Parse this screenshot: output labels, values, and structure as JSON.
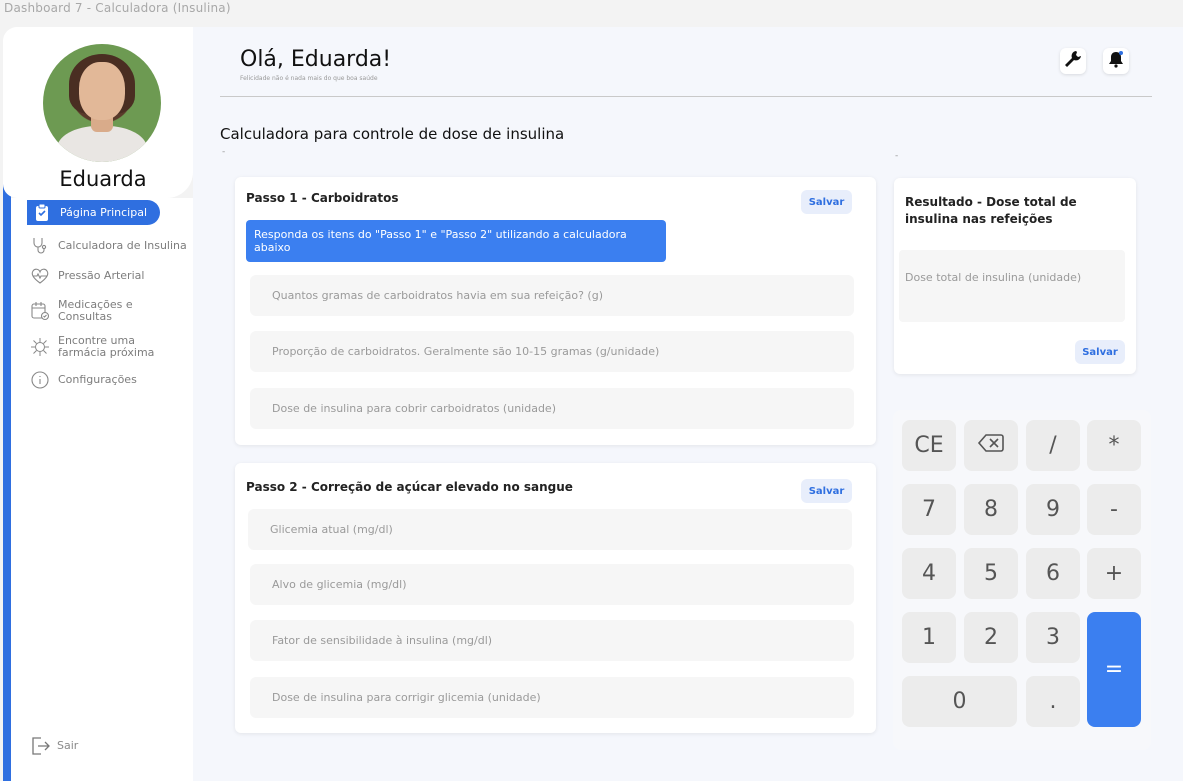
{
  "window_title": "Dashboard 7 - Calculadora (Insulina)",
  "user": {
    "name": "Eduarda"
  },
  "nav": {
    "active": "Página Principal",
    "items": [
      "Calculadora de Insulina",
      "Pressão Arterial",
      "Medicações e Consultas",
      "Encontre uma farmácia próxima",
      "Configurações"
    ],
    "logout": "Sair"
  },
  "header": {
    "greeting": "Olá, Eduarda!",
    "subtitle": "Felicidade não é nada mais do que boa saúde"
  },
  "page_title": "Calculadora para controle de dose de insulina",
  "step1": {
    "title": "Passo 1 - Carboidratos",
    "save": "Salvar",
    "banner": "Responda os itens do \"Passo 1\" e \"Passo 2\" utilizando a calculadora abaixo",
    "fields": [
      "Quantos gramas de carboidratos havia em sua refeição? (g)",
      "Proporção de carboidratos. Geralmente são 10-15 gramas (g/unidade)",
      "Dose de insulina para cobrir carboidratos (unidade)"
    ]
  },
  "step2": {
    "title": "Passo 2 - Correção de açúcar elevado no sangue",
    "save": "Salvar",
    "fields": [
      "Glicemia atual (mg/dl)",
      "Alvo de glicemia (mg/dl)",
      "Fator de sensibilidade à insulina (mg/dl)",
      "Dose de insulina para corrigir glicemia (unidade)"
    ]
  },
  "result": {
    "title": "Resultado - Dose total de insulina nas refeições",
    "field": "Dose total de insulina (unidade)",
    "save": "Salvar"
  },
  "calculator": {
    "keys": [
      "CE",
      "/",
      "*",
      "7",
      "8",
      "9",
      "-",
      "4",
      "5",
      "6",
      "+",
      "1",
      "2",
      "3",
      "=",
      "0",
      "."
    ],
    "backspace_icon": "backspace-icon"
  },
  "colors": {
    "accent": "#2f6fe0",
    "banner": "#3b7ff0"
  }
}
